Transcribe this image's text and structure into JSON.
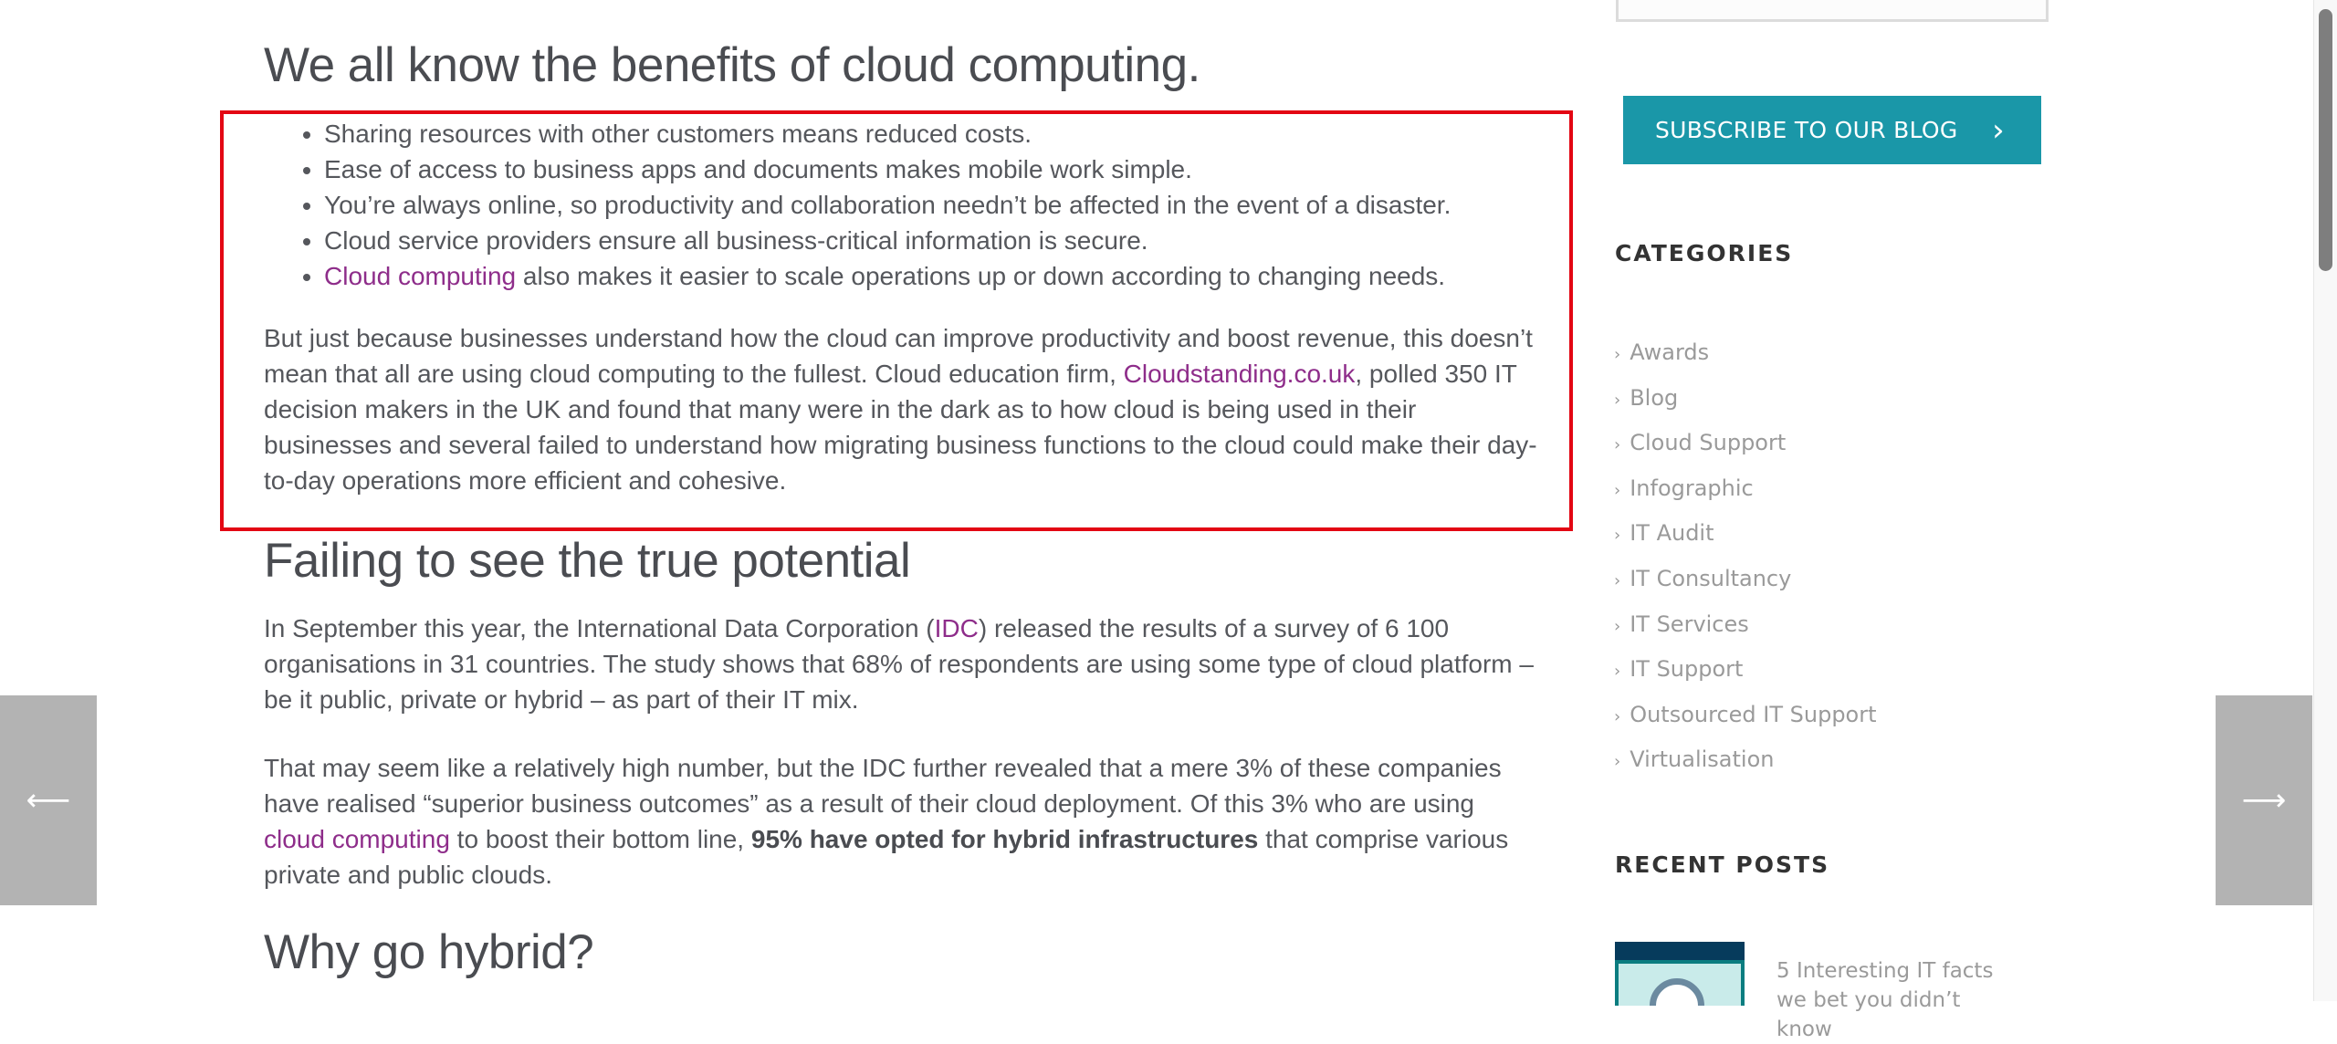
{
  "article": {
    "heading1": "We all know the benefits of cloud computing.",
    "benefits": [
      {
        "text": "Sharing resources with other customers means reduced costs."
      },
      {
        "text": "Ease of access to business apps and documents makes mobile work simple."
      },
      {
        "text": "You’re always online, so productivity and collaboration needn’t be affected in the event of a disaster."
      },
      {
        "text": "Cloud service providers ensure all business-critical information is secure."
      },
      {
        "link": "Cloud computing",
        "text": " also makes it easier to scale operations up or down according to changing needs."
      }
    ],
    "para1": {
      "before": "But just because businesses understand how the cloud can improve productivity and boost revenue, this doesn’t mean that all are using cloud computing to the fullest. Cloud education firm, ",
      "link": "Cloudstanding.co.uk",
      "after": ", polled 350 IT decision makers in the UK and found that many were in the dark as to how cloud is being used in their businesses and several failed to understand how migrating business functions to the cloud could make their day-to-day operations more efficient and cohesive."
    },
    "heading2": "Failing to see the true potential",
    "para2": {
      "before": "In September this year, the International Data Corporation (",
      "link": "IDC",
      "after": ") released the results of a survey of 6 100 organisations in 31 countries. The study shows that 68% of respondents are using some type of cloud platform – be it public, private or hybrid – as part of their IT mix."
    },
    "para3": {
      "before": "That may seem like a relatively high number, but the IDC further revealed that a mere 3%  of these companies have realised “superior business outcomes” as a result of their cloud deployment. Of this 3% who are using ",
      "link": "cloud computing",
      "middle": " to boost their bottom line, ",
      "bold": "95% have opted for hybrid infrastructures",
      "after": " that comprise various private and public clouds."
    },
    "heading3": "Why go hybrid?"
  },
  "sidebar": {
    "subscribe_label": "SUBSCRIBE TO OUR BLOG",
    "subscribe_icon": "›",
    "categories_title": "CATEGORIES",
    "categories": [
      {
        "label": "Awards"
      },
      {
        "label": "Blog"
      },
      {
        "label": "Cloud Support"
      },
      {
        "label": "Infographic"
      },
      {
        "label": "IT Audit"
      },
      {
        "label": "IT Consultancy"
      },
      {
        "label": "IT Services"
      },
      {
        "label": "IT Support"
      },
      {
        "label": "Outsourced IT Support"
      },
      {
        "label": "Virtualisation"
      }
    ],
    "category_arrow": "›",
    "recent_title": "RECENT POSTS",
    "recent_posts": [
      {
        "title": "5 Interesting IT facts we bet you didn’t know"
      }
    ]
  },
  "nav": {
    "prev_icon": "⟵",
    "next_icon": "⟶"
  },
  "colors": {
    "accent": "#1a97a8",
    "link": "#8e2d8a",
    "highlight": "#e30613"
  }
}
